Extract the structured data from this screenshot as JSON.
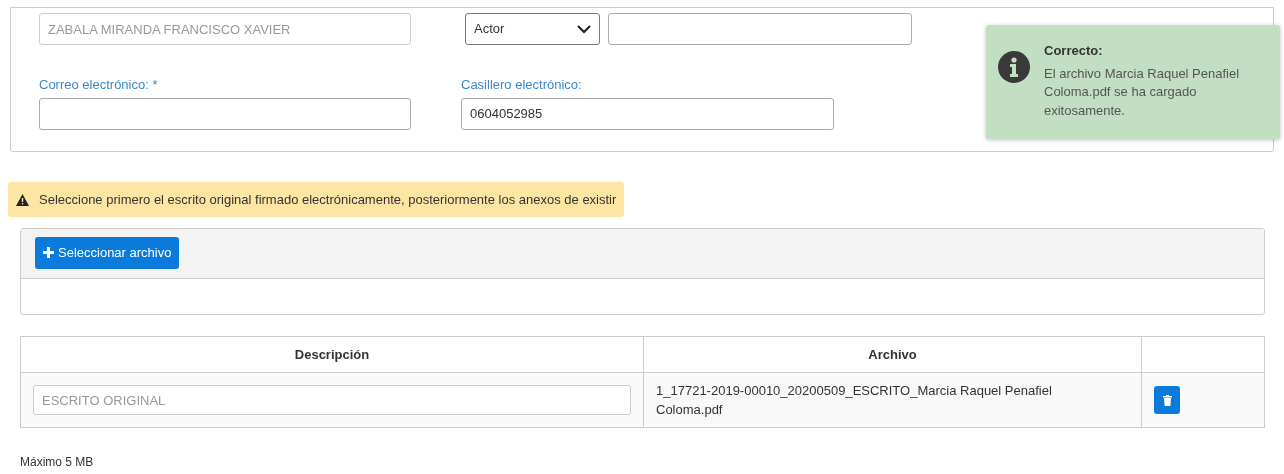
{
  "form": {
    "fields": [
      {
        "kind": "input",
        "value": "ZABALA MIRANDA FRANCISCO XAVIER",
        "disabled": true
      },
      {
        "kind": "select",
        "value": "Actor"
      },
      {
        "kind": "input"
      },
      {
        "kind": "input",
        "label": "Correo electrónico:",
        "required_mark": "*"
      },
      {
        "kind": "input",
        "label": "Casillero electrónico:",
        "value": "0604052985"
      }
    ]
  },
  "toast": {
    "title": "Correcto:",
    "message": "El archivo Marcia Raquel Penafiel Coloma.pdf se ha cargado exitosamente."
  },
  "warning": {
    "text": "Seleccione primero el escrito original firmado electrónicamente, posteriormente los anexos de existir"
  },
  "upload": {
    "button": "Seleccionar archivo"
  },
  "table": {
    "columns": [
      "Descripción",
      "Archivo"
    ],
    "rows": [
      {
        "description": "ESCRITO ORIGINAL",
        "file": "1_17721-2019-00010_20200509_ESCRITO_Marcia Raquel Penafiel Coloma.pdf"
      }
    ]
  },
  "footer": {
    "text": "Máximo 5 MB"
  }
}
